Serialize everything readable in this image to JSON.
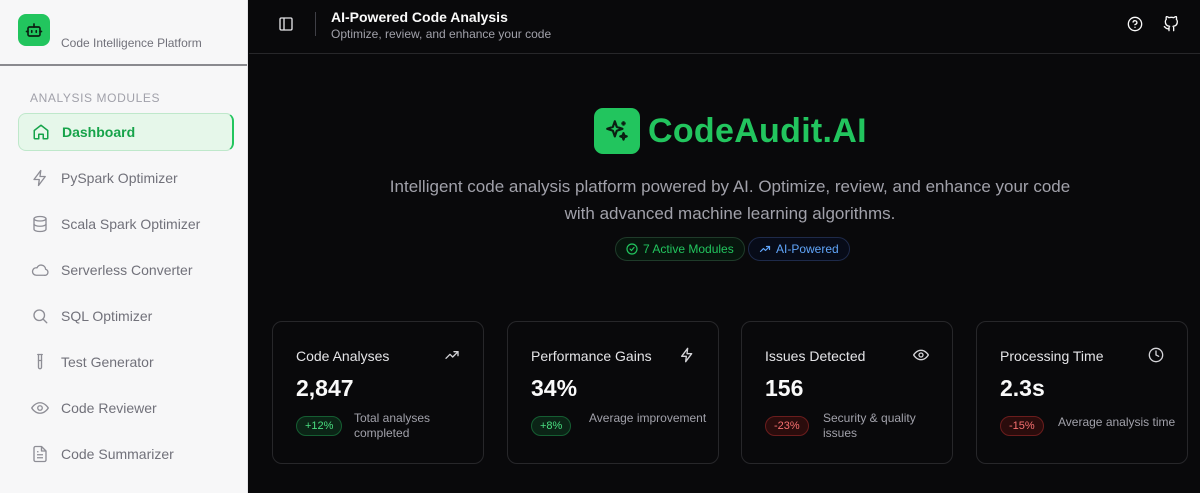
{
  "sidebar": {
    "brand_subtitle": "Code Intelligence Platform",
    "section_label": "ANALYSIS MODULES",
    "items": [
      {
        "label": "Dashboard",
        "icon": "home-icon",
        "active": true
      },
      {
        "label": "PySpark Optimizer",
        "icon": "lightning-icon"
      },
      {
        "label": "Scala Spark Optimizer",
        "icon": "database-icon"
      },
      {
        "label": "Serverless Converter",
        "icon": "cloud-icon"
      },
      {
        "label": "SQL Optimizer",
        "icon": "search-icon"
      },
      {
        "label": "Test Generator",
        "icon": "test-tube-icon"
      },
      {
        "label": "Code Reviewer",
        "icon": "eye-icon"
      },
      {
        "label": "Code Summarizer",
        "icon": "file-text-icon"
      }
    ]
  },
  "header": {
    "title": "AI-Powered Code Analysis",
    "subtitle": "Optimize, review, and enhance your code"
  },
  "hero": {
    "title": "CodeAudit.AI",
    "description": "Intelligent code analysis platform powered by AI. Optimize, review, and enhance your code with advanced machine learning algorithms.",
    "badges": [
      "7 Active Modules",
      "AI-Powered"
    ]
  },
  "stats": [
    {
      "title": "Code Analyses",
      "value": "2,847",
      "delta": "+12%",
      "note": "Total analyses completed",
      "trend": "positive",
      "icon": "trending-up-icon"
    },
    {
      "title": "Performance Gains",
      "value": "34%",
      "delta": "+8%",
      "note": "Average improvement",
      "trend": "positive",
      "icon": "lightning-icon"
    },
    {
      "title": "Issues Detected",
      "value": "156",
      "delta": "-23%",
      "note": "Security & quality issues",
      "trend": "negative",
      "icon": "eye-icon"
    },
    {
      "title": "Processing Time",
      "value": "2.3s",
      "delta": "-15%",
      "note": "Average analysis time",
      "trend": "negative",
      "icon": "clock-icon"
    }
  ],
  "colors": {
    "accent": "#22c55e",
    "background": "#09090b",
    "sidebar_bg": "#f7f7f8",
    "info": "#60a5fa",
    "negative": "#f87171"
  }
}
